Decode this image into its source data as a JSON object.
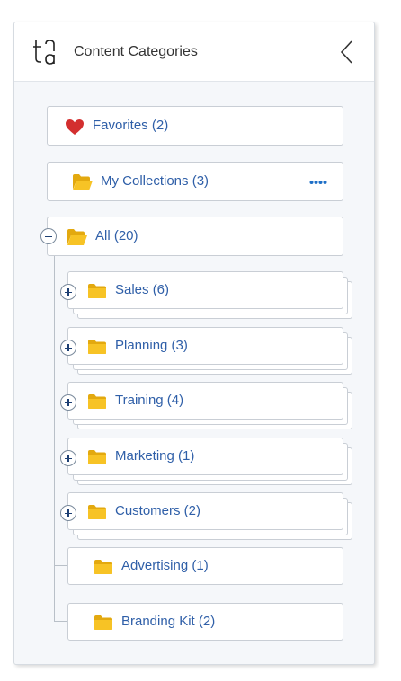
{
  "header": {
    "title": "Content Categories",
    "logo_icon": "tg-logo-icon",
    "collapse_icon": "chevron-left-icon"
  },
  "favorites": {
    "label": "Favorites (2)",
    "icon": "heart-icon",
    "color": "#d32f2f"
  },
  "my_collections": {
    "label": "My Collections (3)",
    "icon": "folder-open-icon",
    "menu_icon": "more-horizontal-icon"
  },
  "all": {
    "label": "All (20)",
    "icon": "folder-open-icon",
    "toggle": "collapse"
  },
  "categories": [
    {
      "label": "Sales (6)",
      "expandable": true
    },
    {
      "label": "Planning (3)",
      "expandable": true
    },
    {
      "label": "Training (4)",
      "expandable": true
    },
    {
      "label": "Marketing (1)",
      "expandable": true
    },
    {
      "label": "Customers (2)",
      "expandable": true
    },
    {
      "label": "Advertising (1)",
      "expandable": false
    },
    {
      "label": "Branding Kit (2)",
      "expandable": false
    }
  ],
  "colors": {
    "link": "#2f5fa8",
    "folder": "#f7c325",
    "folder_dark": "#e3a90f",
    "accent": "#1e6fc7"
  }
}
